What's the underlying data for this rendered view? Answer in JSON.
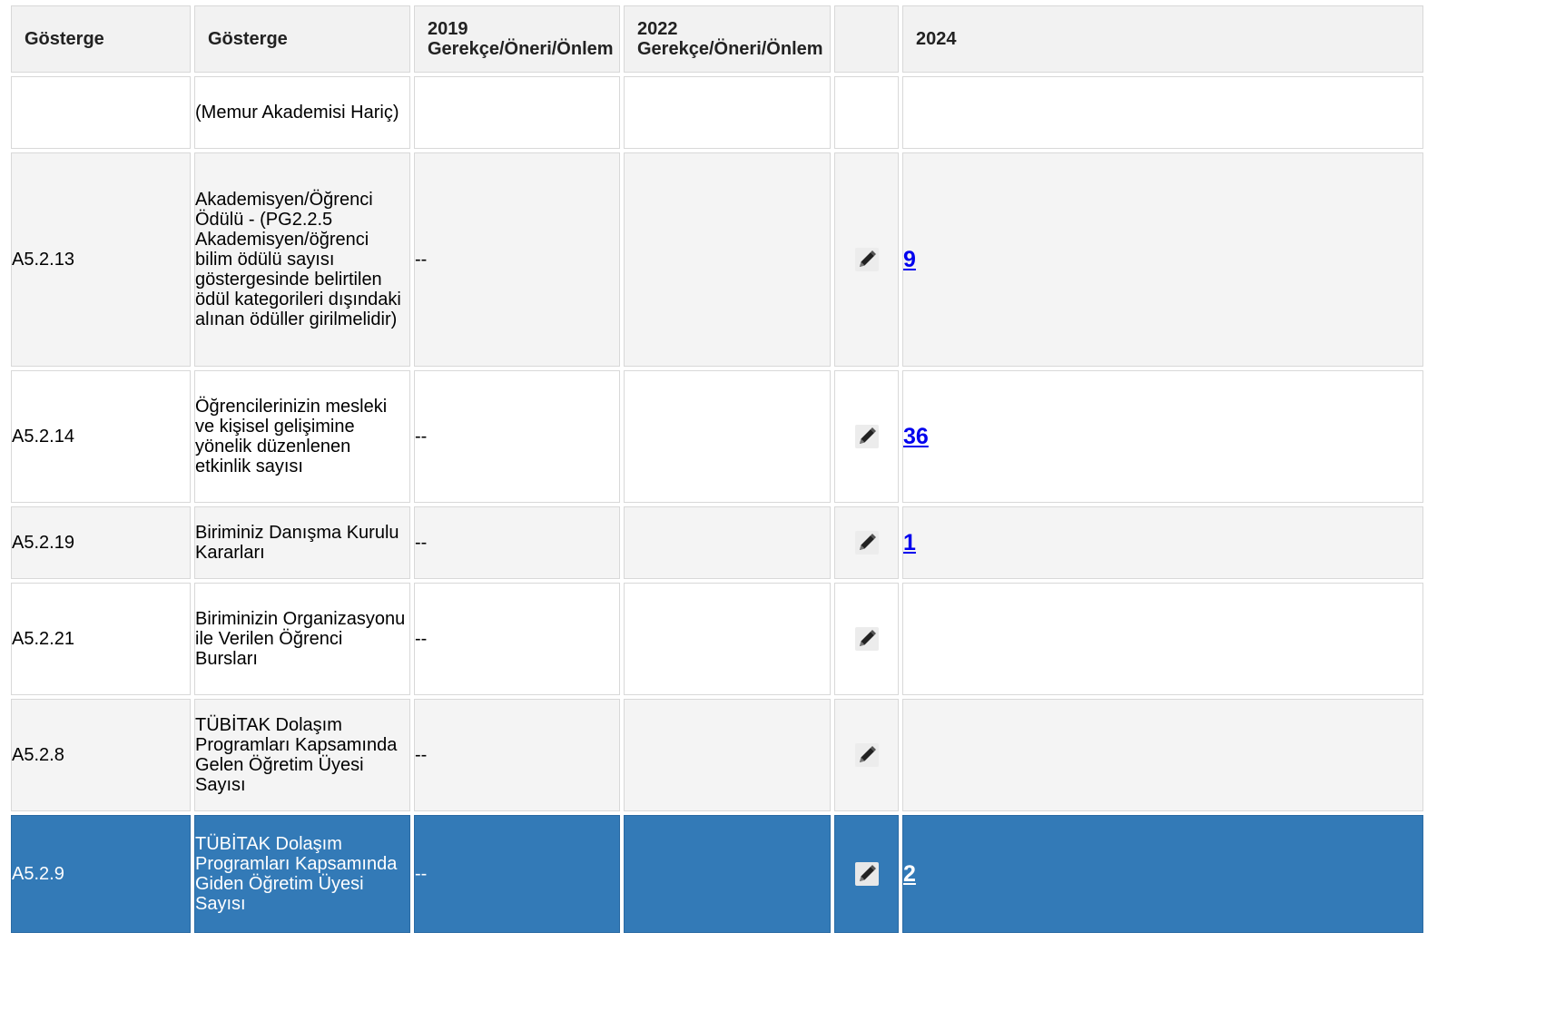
{
  "table": {
    "headers": [
      {
        "label": "Gösterge"
      },
      {
        "label": "Gösterge"
      },
      {
        "line1": "2019",
        "line2": "Gerekçe/Öneri/Önlem"
      },
      {
        "line1": "2022",
        "line2": "Gerekçe/Öneri/Önlem"
      },
      {
        "label": ""
      },
      {
        "label": "2024"
      }
    ],
    "rows": [
      {
        "code": "",
        "desc": "(Memur Akademisi Hariç)",
        "v2019": "",
        "v2022": "",
        "value": ""
      },
      {
        "code": "A5.2.13",
        "desc": "Akademisyen/Öğrenci Ödülü - (PG2.2.5 Akademisyen/öğrenci bilim ödülü sayısı göstergesinde belirtilen ödül kategorileri dışındaki alınan ödüller girilmelidir)",
        "v2019": "--",
        "v2022": "",
        "value": "9"
      },
      {
        "code": "A5.2.14",
        "desc": "Öğrencilerinizin mesleki ve kişisel gelişimine yönelik düzenlenen etkinlik sayısı",
        "v2019": "--",
        "v2022": "",
        "value": "36"
      },
      {
        "code": "A5.2.19",
        "desc": "Biriminiz Danışma Kurulu Kararları",
        "v2019": "--",
        "v2022": "",
        "value": "1"
      },
      {
        "code": "A5.2.21",
        "desc": "Biriminizin Organizasyonu ile Verilen Öğrenci Bursları",
        "v2019": "--",
        "v2022": "",
        "value": ""
      },
      {
        "code": "A5.2.8",
        "desc": "TÜBİTAK Dolaşım Programları Kapsamında Gelen Öğretim Üyesi Sayısı",
        "v2019": "--",
        "v2022": "",
        "value": ""
      },
      {
        "code": "A5.2.9",
        "desc": "TÜBİTAK Dolaşım Programları Kapsamında Giden Öğretim Üyesi Sayısı",
        "v2019": "--",
        "v2022": "",
        "value": "2"
      }
    ],
    "selected_row": 6
  },
  "icons": {
    "edit": "pencil-icon"
  },
  "colors": {
    "selected_row_bg": "#337ab7",
    "link": "#0000ee",
    "header_bg": "#f2f2f2",
    "alt_row_bg": "#f4f4f4"
  }
}
